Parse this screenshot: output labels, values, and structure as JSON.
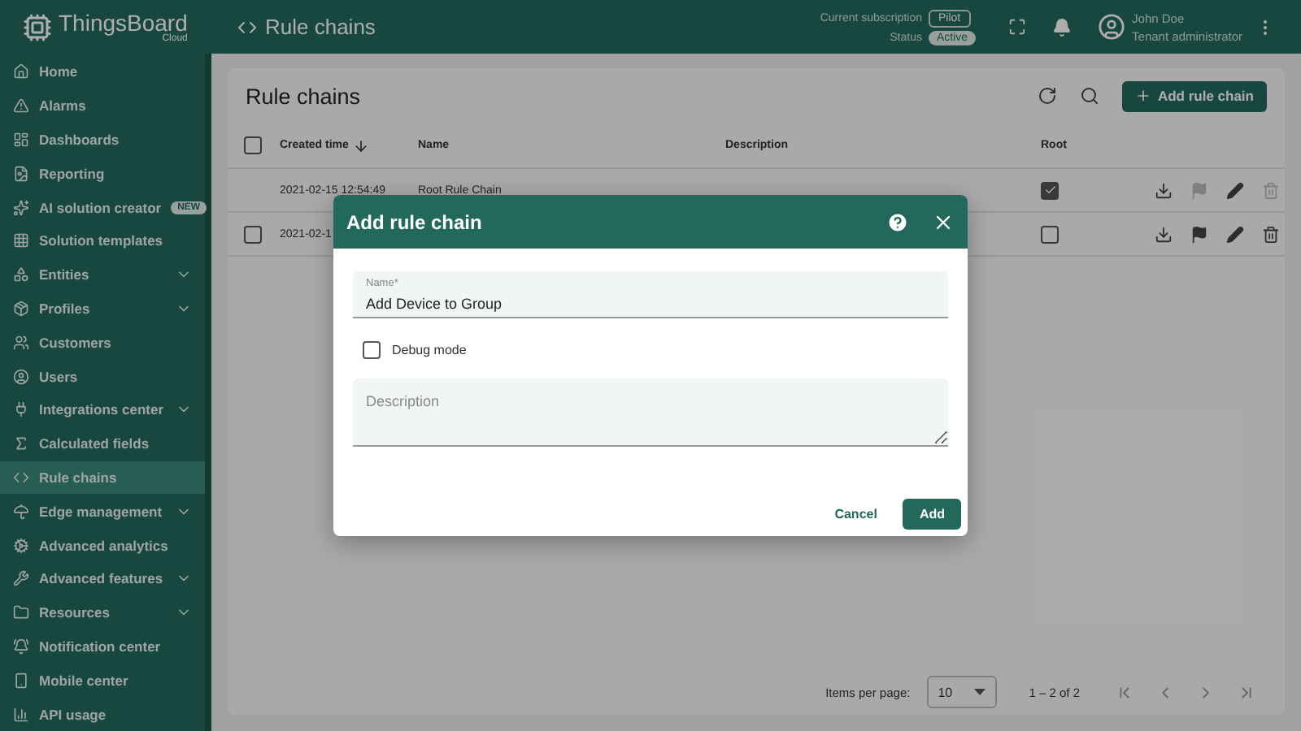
{
  "brand": {
    "name": "ThingsBoard",
    "edition": "Cloud"
  },
  "header": {
    "breadcrumb": "Rule chains",
    "subscription_label": "Current subscription",
    "subscription": "Pilot",
    "status_label": "Status",
    "status": "Active",
    "user_name": "John Doe",
    "user_role": "Tenant administrator"
  },
  "sidebar": {
    "items": [
      {
        "label": "Home",
        "selected": false,
        "expandable": false
      },
      {
        "label": "Alarms",
        "selected": false,
        "expandable": false
      },
      {
        "label": "Dashboards",
        "selected": false,
        "expandable": false
      },
      {
        "label": "Reporting",
        "selected": false,
        "expandable": false
      },
      {
        "label": "AI solution creator",
        "selected": false,
        "expandable": false,
        "badge": "NEW"
      },
      {
        "label": "Solution templates",
        "selected": false,
        "expandable": false
      },
      {
        "label": "Entities",
        "selected": false,
        "expandable": true
      },
      {
        "label": "Profiles",
        "selected": false,
        "expandable": true
      },
      {
        "label": "Customers",
        "selected": false,
        "expandable": false
      },
      {
        "label": "Users",
        "selected": false,
        "expandable": false
      },
      {
        "label": "Integrations center",
        "selected": false,
        "expandable": true
      },
      {
        "label": "Calculated fields",
        "selected": false,
        "expandable": false
      },
      {
        "label": "Rule chains",
        "selected": true,
        "expandable": false
      },
      {
        "label": "Edge management",
        "selected": false,
        "expandable": true
      },
      {
        "label": "Advanced analytics",
        "selected": false,
        "expandable": false
      },
      {
        "label": "Advanced features",
        "selected": false,
        "expandable": true
      },
      {
        "label": "Resources",
        "selected": false,
        "expandable": true
      },
      {
        "label": "Notification center",
        "selected": false,
        "expandable": false
      },
      {
        "label": "Mobile center",
        "selected": false,
        "expandable": false
      },
      {
        "label": "API usage",
        "selected": false,
        "expandable": false
      }
    ]
  },
  "table": {
    "title": "Rule chains",
    "add_button": "Add rule chain",
    "select_all_checked": false,
    "columns": [
      "Created time",
      "Name",
      "Description",
      "Root"
    ],
    "rows": [
      {
        "selectable": false,
        "created": "2021-02-15 12:54:49",
        "name": "Root Rule Chain",
        "root": true,
        "actions": [
          {
            "disabled": false
          },
          {
            "disabled": true
          },
          {
            "disabled": false
          },
          {
            "disabled": true
          }
        ]
      },
      {
        "selectable": true,
        "checked": false,
        "created": "2021-02-1",
        "root": false,
        "actions": [
          {
            "disabled": false
          },
          {
            "disabled": false
          },
          {
            "disabled": false
          },
          {
            "disabled": false
          }
        ]
      }
    ],
    "pagination": {
      "items_label": "Items per page:",
      "page_size": "10",
      "range": "1 – 2 of 2"
    }
  },
  "dialog": {
    "title": "Add rule chain",
    "name_label": "Name*",
    "name_value": "Add Device to Group",
    "debug_label": "Debug mode",
    "debug_checked": false,
    "description_placeholder": "Description",
    "cancel": "Cancel",
    "add": "Add"
  }
}
